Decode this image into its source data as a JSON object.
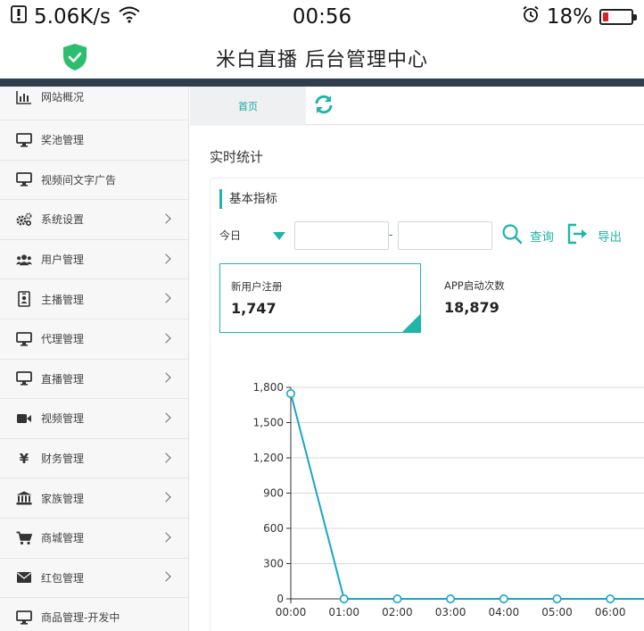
{
  "status_bar": {
    "speed": "5.06K/s",
    "time": "00:56",
    "battery": "18%",
    "battery_level": 0.18,
    "icons": [
      "notification-icon",
      "wifi-icon",
      "alarm-icon",
      "battery-icon"
    ]
  },
  "header": {
    "title": "米白直播 后台管理中心",
    "logo_icon": "shield-check-icon"
  },
  "colors": {
    "accent": "#1fb5a8",
    "dark_bar": "#2f3e4d",
    "shield": "#2dbd6e",
    "battery_low": "#e02020",
    "line": "#1aa5c4"
  },
  "sidebar": {
    "items": [
      {
        "label": "网站概况",
        "icon": "bar-chart-icon",
        "expandable": false
      },
      {
        "label": "奖池管理",
        "icon": "monitor-icon",
        "expandable": false
      },
      {
        "label": "视频间文字广告",
        "icon": "monitor-icon",
        "expandable": false
      },
      {
        "label": "系统设置",
        "icon": "gears-icon",
        "expandable": true
      },
      {
        "label": "用户管理",
        "icon": "users-icon",
        "expandable": true
      },
      {
        "label": "主播管理",
        "icon": "id-badge-icon",
        "expandable": true
      },
      {
        "label": "代理管理",
        "icon": "monitor-icon",
        "expandable": true
      },
      {
        "label": "直播管理",
        "icon": "monitor-icon",
        "expandable": true
      },
      {
        "label": "视频管理",
        "icon": "video-camera-icon",
        "expandable": true
      },
      {
        "label": "财务管理",
        "icon": "yen-icon",
        "expandable": true
      },
      {
        "label": "家族管理",
        "icon": "bank-icon",
        "expandable": true
      },
      {
        "label": "商城管理",
        "icon": "cart-icon",
        "expandable": true
      },
      {
        "label": "红包管理",
        "icon": "envelope-icon",
        "expandable": true
      },
      {
        "label": "商品管理-开发中",
        "icon": "monitor-icon",
        "expandable": false
      }
    ]
  },
  "tabs": {
    "home_label": "首页",
    "refresh_icon": "refresh-icon"
  },
  "main": {
    "section_title": "实时统计",
    "card_title": "基本指标",
    "filter": {
      "range_selected": "今日",
      "date_from": "",
      "date_to": "",
      "separator": "-",
      "query_label": "查询",
      "export_label": "导出"
    },
    "stats": [
      {
        "label": "新用户注册",
        "value": "1,747",
        "active": true
      },
      {
        "label": "APP启动次数",
        "value": "18,879",
        "active": false
      }
    ]
  },
  "chart_data": {
    "type": "line",
    "categories": [
      "00:00",
      "01:00",
      "02:00",
      "03:00",
      "04:00",
      "05:00",
      "06:00"
    ],
    "series": [
      {
        "values": [
          1747,
          0,
          0,
          0,
          0,
          0,
          0
        ]
      }
    ],
    "ylim": [
      0,
      1800
    ],
    "yticks": [
      "0",
      "300",
      "600",
      "900",
      "1,200",
      "1,500",
      "1,800"
    ],
    "ytick_values": [
      0,
      300,
      600,
      900,
      1200,
      1500,
      1800
    ],
    "grid": true,
    "legend": "none"
  }
}
